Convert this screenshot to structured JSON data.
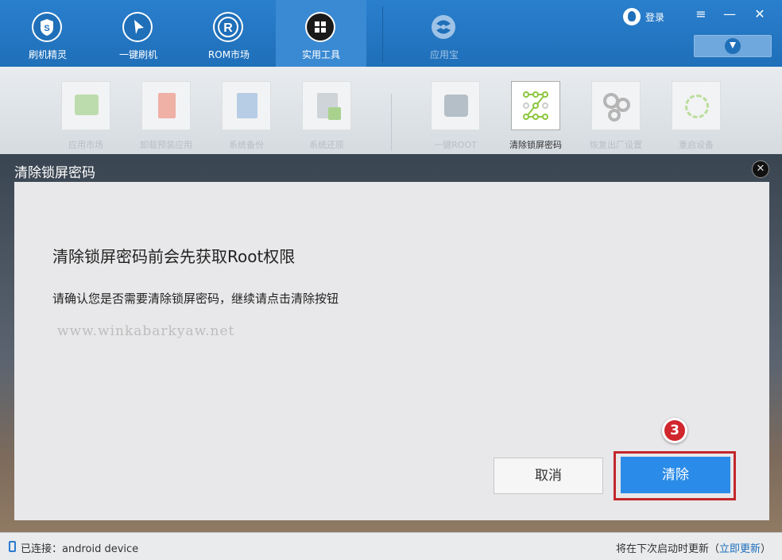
{
  "nav": {
    "items": [
      {
        "label": "刷机精灵",
        "icon": "shield-s-icon"
      },
      {
        "label": "一键刷机",
        "icon": "cursor-icon"
      },
      {
        "label": "ROM市场",
        "icon": "r-letter-icon"
      },
      {
        "label": "实用工具",
        "icon": "grid-icon"
      },
      {
        "label": "应用宝",
        "icon": "appstore-icon"
      }
    ],
    "login_label": "登录",
    "menu_glyph": "≡",
    "minimize_glyph": "—",
    "close_glyph": "✕"
  },
  "tools": [
    {
      "label": "应用市场",
      "icon": "store-bag-icon"
    },
    {
      "label": "卸载预装应用",
      "icon": "trash-icon"
    },
    {
      "label": "系统备份",
      "icon": "backup-icon"
    },
    {
      "label": "系统还原",
      "icon": "restore-icon"
    },
    {
      "label": "一键ROOT",
      "icon": "android-root-icon"
    },
    {
      "label": "清除锁屏密码",
      "icon": "unlock-pattern-icon"
    },
    {
      "label": "恢复出厂设置",
      "icon": "gears-icon"
    },
    {
      "label": "重启设备",
      "icon": "reboot-icon"
    }
  ],
  "dialog": {
    "title": "清除锁屏密码",
    "close_glyph": "✕",
    "heading": "清除锁屏密码前会先获取Root权限",
    "description": "请确认您是否需要清除锁屏密码，继续请点击清除按钮",
    "watermark": "www.winkabarkyaw.net",
    "cancel_label": "取消",
    "confirm_label": "清除",
    "step_number": "3"
  },
  "status": {
    "connection": "已连接：android device",
    "update_text": "将在下次启动时更新（",
    "update_link": "立即更新",
    "update_close": "）"
  },
  "colors": {
    "nav_blue": "#1f6fb9",
    "primary_button": "#2b8be8",
    "highlight_red": "#c3272b"
  }
}
